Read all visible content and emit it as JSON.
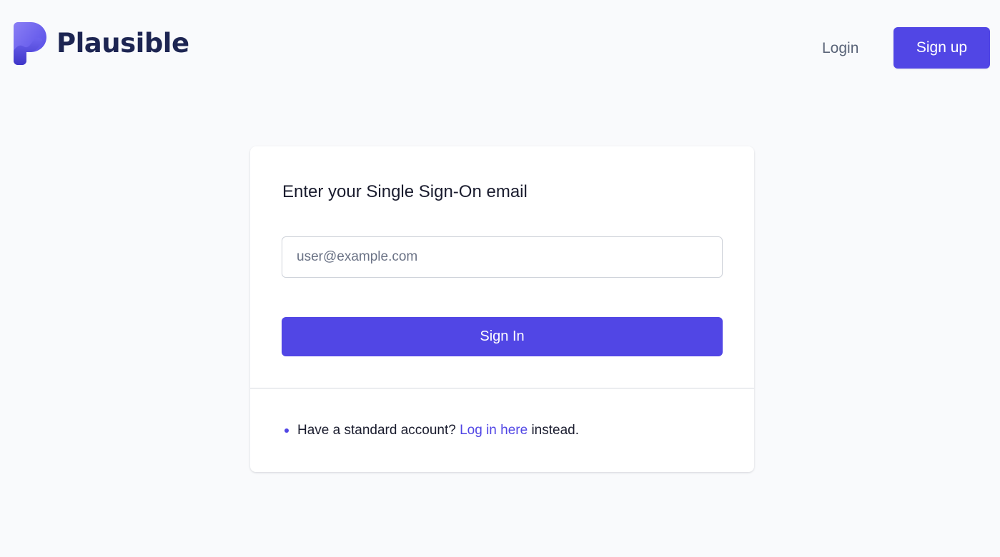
{
  "header": {
    "brand_name": "Plausible",
    "logo_icon": "plausible-logo-icon",
    "login_label": "Login",
    "signup_label": "Sign up"
  },
  "sso_card": {
    "title": "Enter your Single Sign-On email",
    "email_placeholder": "user@example.com",
    "email_value": "",
    "submit_label": "Sign In",
    "footer": {
      "prefix": "Have a standard account?",
      "link_text": "Log in here",
      "suffix": "instead."
    }
  },
  "colors": {
    "accent": "#5146e5",
    "background": "#f9fafc",
    "brand_text": "#1d2552",
    "muted_text": "#5a6478"
  }
}
